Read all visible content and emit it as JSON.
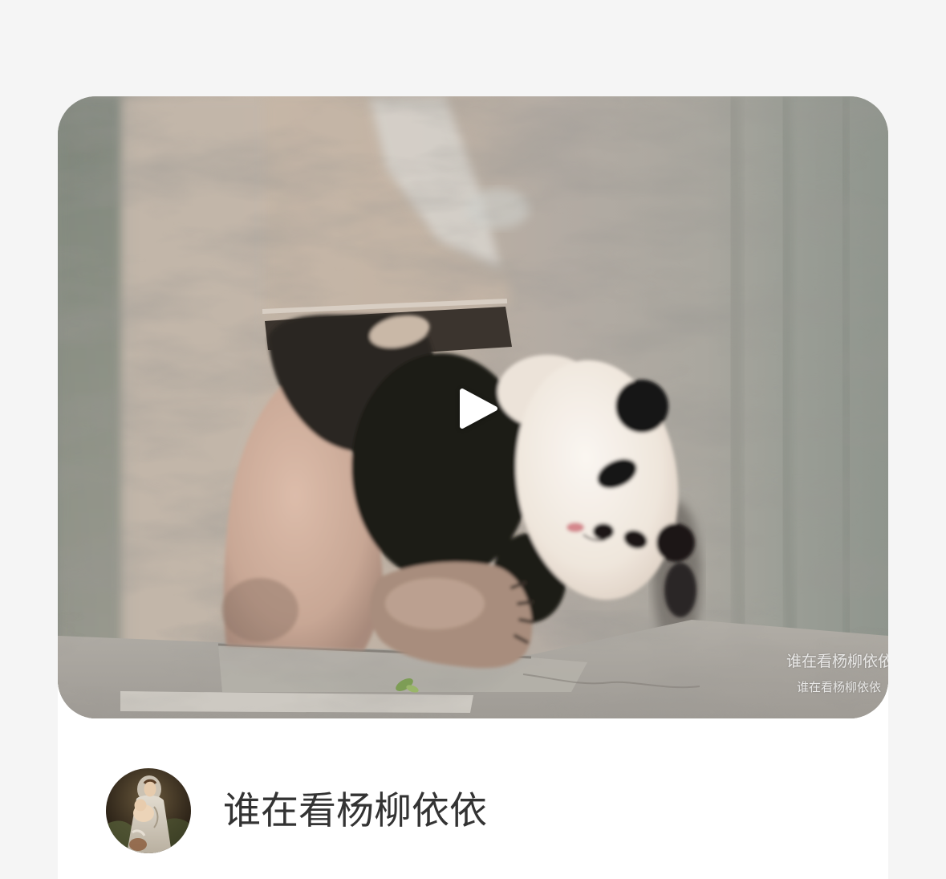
{
  "page": {
    "background": "#f5f5f5"
  },
  "post": {
    "card_background": "#ffffff",
    "video": {
      "play_icon": "play-icon",
      "watermark": [
        "谁在看杨柳依依",
        "谁在看杨柳依依"
      ]
    },
    "author": {
      "avatar_icon": "avatar-image",
      "name": "谁在看杨柳依依",
      "name_color": "#333333"
    }
  }
}
